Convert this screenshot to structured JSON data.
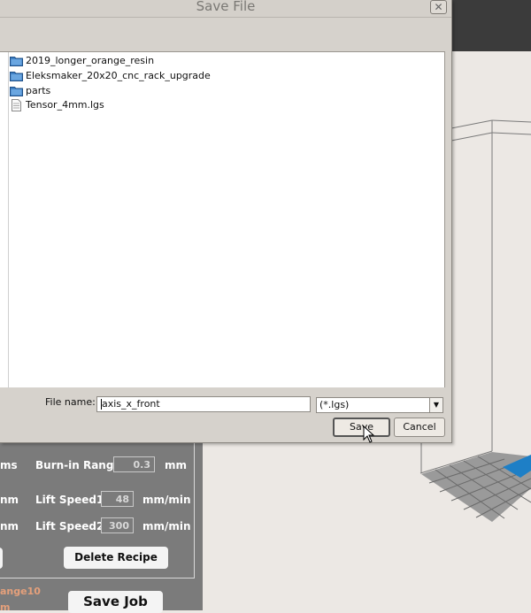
{
  "dialog": {
    "title": "Save File",
    "close_glyph": "✕",
    "files": [
      {
        "name": "2019_longer_orange_resin",
        "type": "folder",
        "icon": "folder-icon"
      },
      {
        "name": "Eleksmaker_20x20_cnc_rack_upgrade",
        "type": "folder",
        "icon": "folder-icon"
      },
      {
        "name": "parts",
        "type": "folder",
        "icon": "folder-icon"
      },
      {
        "name": "Tensor_4mm.lgs",
        "type": "file",
        "icon": "document-icon"
      }
    ],
    "filename_label": "File name:",
    "filename_value": "axis_x_front",
    "filter_value": "(*.lgs)",
    "filter_arrow": "▼",
    "save_label": "Save",
    "cancel_label": "Cancel"
  },
  "panel": {
    "row1_left_unit": "ms",
    "burnin_label": "Burn-in Range",
    "burnin_value": "0.3",
    "burnin_unit": "mm",
    "row2_left_unit": "nm",
    "lift1_label": "Lift Speed1",
    "lift1_value": "48",
    "lift1_unit": "mm/min",
    "row3_left_unit": "nm",
    "lift2_label": "Lift Speed2",
    "lift2_value": "300",
    "lift2_unit": "mm/min",
    "delete_recipe_label": "Delete Recipe",
    "orange_label": "ange10",
    "orange_label2": "m",
    "save_job_label": "Save Job"
  },
  "colors": {
    "dialog_bg": "#d6d2cc",
    "panel_bg": "#7b7b7b",
    "viewport_bg": "#ece8e4",
    "folder_blue": "#3d7fc4",
    "accent_orange": "#e5a07b"
  }
}
